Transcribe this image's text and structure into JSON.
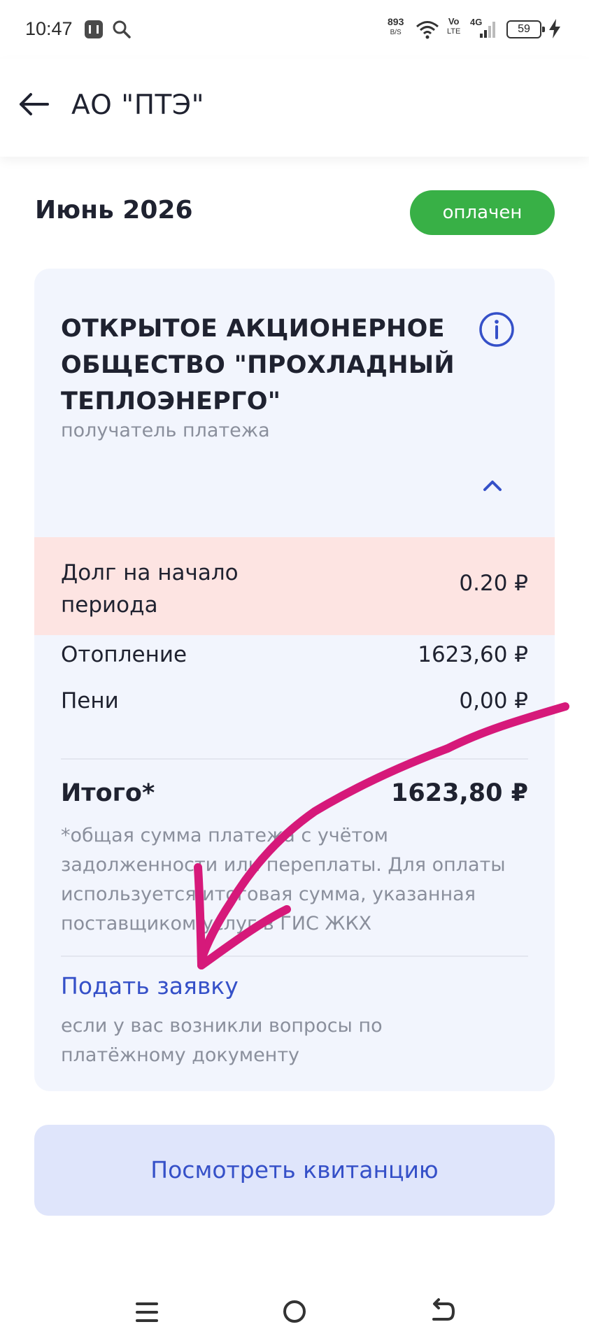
{
  "status_bar": {
    "time": "10:47",
    "net_speed": "893",
    "net_speed_unit": "B/S",
    "volte": "Vo",
    "volte_sub": "LTE",
    "network": "4G",
    "battery": "59"
  },
  "header": {
    "title": "АО \"ПТЭ\""
  },
  "period": {
    "title": "Июнь 2026",
    "status": "оплачен",
    "status_color": "#38b046"
  },
  "recipient": {
    "name": "ОТКРЫТОЕ АКЦИОНЕРНОЕ ОБЩЕСТВО \"ПРОХЛАДНЫЙ ТЕПЛОЭНЕРГО\"",
    "caption": "получатель платежа"
  },
  "debt": {
    "label": "Долг на начало периода",
    "value": "0.20 ₽"
  },
  "lines": [
    {
      "label": "Отопление",
      "value": "1623,60 ₽"
    },
    {
      "label": "Пени",
      "value": "0,00 ₽"
    }
  ],
  "total": {
    "label": "Итого*",
    "value": "1623,80 ₽",
    "note": "*общая сумма платежа с учётом задолженности или переплаты. Для оплаты используется итоговая сумма, указанная поставщиком услуг в ГИС ЖКХ"
  },
  "request": {
    "link": "Подать заявку",
    "caption": "если у вас возникли вопросы по платёжному документу"
  },
  "receipt_button": "Посмотреть квитанцию",
  "colors": {
    "accent": "#3550c8",
    "card_bg": "#f2f5fd",
    "debt_bg": "#fde4e2",
    "annotation": "#d6197a"
  }
}
